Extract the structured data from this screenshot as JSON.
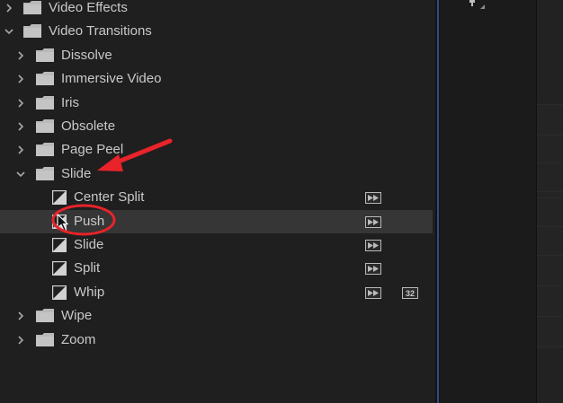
{
  "tree": [
    {
      "label": "Video Effects",
      "type": "folder",
      "expanded": false,
      "level": 0
    },
    {
      "label": "Video Transitions",
      "type": "folder",
      "expanded": true,
      "level": 0
    },
    {
      "label": "Dissolve",
      "type": "folder",
      "expanded": false,
      "level": 1
    },
    {
      "label": "Immersive Video",
      "type": "folder",
      "expanded": false,
      "level": 1
    },
    {
      "label": "Iris",
      "type": "folder",
      "expanded": false,
      "level": 1
    },
    {
      "label": "Obsolete",
      "type": "folder",
      "expanded": false,
      "level": 1
    },
    {
      "label": "Page Peel",
      "type": "folder",
      "expanded": false,
      "level": 1
    },
    {
      "label": "Slide",
      "type": "folder",
      "expanded": true,
      "level": 1
    },
    {
      "label": "Center Split",
      "type": "effect",
      "level": 2,
      "accelerated": true,
      "bit32": false
    },
    {
      "label": "Push",
      "type": "effect",
      "level": 2,
      "accelerated": true,
      "bit32": false,
      "selected": true
    },
    {
      "label": "Slide",
      "type": "effect",
      "level": 2,
      "accelerated": true,
      "bit32": false
    },
    {
      "label": "Split",
      "type": "effect",
      "level": 2,
      "accelerated": true,
      "bit32": false
    },
    {
      "label": "Whip",
      "type": "effect",
      "level": 2,
      "accelerated": true,
      "bit32": true
    },
    {
      "label": "Wipe",
      "type": "folder",
      "expanded": false,
      "level": 1
    },
    {
      "label": "Zoom",
      "type": "folder",
      "expanded": false,
      "level": 1
    }
  ],
  "badges": {
    "bit32_text": "32"
  },
  "icons": {
    "collapsed": "chevron-right-icon",
    "expanded": "chevron-down-icon",
    "folder": "folder-icon",
    "effect": "transition-preset-icon",
    "accelerated": "accelerated-effect-icon",
    "bit32": "32-bit-icon"
  },
  "colors": {
    "annotation": "#e8232a",
    "selected_row": "#363636",
    "text": "#c9c9c9",
    "accent": "#2f4a86"
  }
}
